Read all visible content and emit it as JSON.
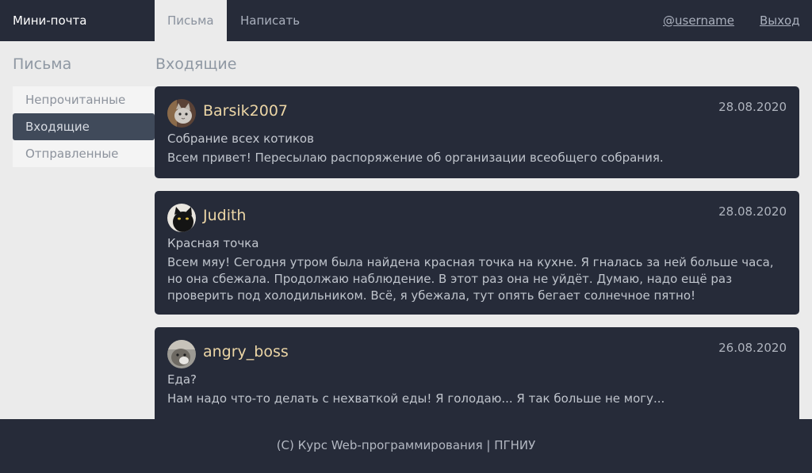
{
  "header": {
    "brand": "Мини-почта",
    "tabs": [
      {
        "label": "Письма",
        "active": true
      },
      {
        "label": "Написать",
        "active": false
      }
    ],
    "user_link": "@username",
    "logout_link": "Выход"
  },
  "sidebar": {
    "title": "Письма",
    "items": [
      {
        "label": "Непрочитанные",
        "active": false
      },
      {
        "label": "Входящие",
        "active": true
      },
      {
        "label": "Отправленные",
        "active": false
      }
    ]
  },
  "main": {
    "title": "Входящие",
    "letters": [
      {
        "author": "Barsik2007",
        "date": "28.08.2020",
        "subject": "Собрание всех котиков",
        "preview": "Всем привет! Пересылаю распоряжение об организации всеобщего собрания.",
        "avatar": "cat-avatar"
      },
      {
        "author": "Judith",
        "date": "28.08.2020",
        "subject": "Красная точка",
        "preview": "Всем мяу! Сегодня утром была найдена красная точка на кухне. Я гналась за ней больше часа, но она сбежала. Продолжаю наблюдение. В этот раз она не уйдёт. Думаю, надо ещё раз проверить под холодильником. Всё, я убежала, тут опять бегает солнечное пятно!",
        "avatar": "black-cat-avatar"
      },
      {
        "author": "angry_boss",
        "date": "26.08.2020",
        "subject": "Еда?",
        "preview": "Нам надо что-то делать с нехваткой еды! Я голодаю... Я так больше не могу...",
        "avatar": "grey-cat-avatar"
      }
    ]
  },
  "footer": {
    "text": "(С) Курс Web-программирования | ПГНИУ"
  },
  "colors": {
    "dark": "#262b39",
    "background": "#ebebeb",
    "author": "#ecd6a6",
    "active_side": "#404a5a"
  }
}
